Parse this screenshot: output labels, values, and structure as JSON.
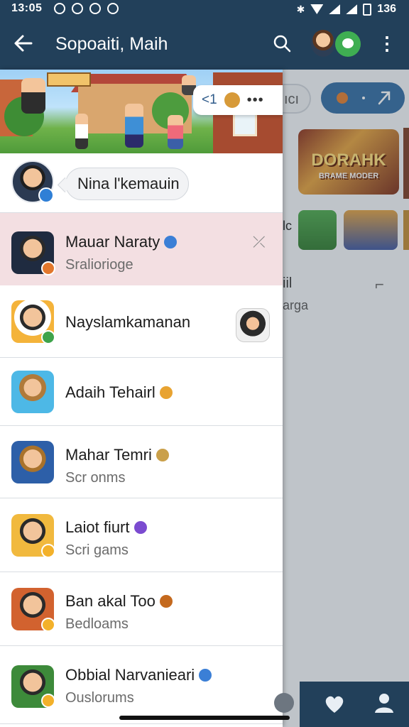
{
  "status_bar": {
    "time": "13:05",
    "battery": "136"
  },
  "app_bar": {
    "title": "Sopoaiti, Maih"
  },
  "drawer": {
    "banner_pill": {
      "label": "<1",
      "dots": "•••"
    },
    "profile": {
      "bubble_text": "Nina l'kemauin"
    },
    "chats": [
      {
        "name": "Mauar Naraty",
        "subtitle": "Sraliorioge",
        "trailing": "⤫",
        "active": true
      },
      {
        "name": "Nayslamkamanan",
        "subtitle": "",
        "active": false
      },
      {
        "name": "Adaih Tehairl",
        "subtitle": "",
        "active": false
      },
      {
        "name": "Mahar Temri",
        "subtitle": "Scr onms",
        "active": false
      },
      {
        "name": "Laiot fiurt",
        "subtitle": "Scri gams",
        "active": false
      },
      {
        "name": "Ban akal Too",
        "subtitle": "Bedloams",
        "active": false
      },
      {
        "name": "Obbial Narvanieari",
        "subtitle": "Ouslorums",
        "active": false
      }
    ]
  },
  "background_screen": {
    "pill_left": "ıcı",
    "game_title": "DORAHK",
    "game_subtitle": "BRAME MODER",
    "side_label": "lc",
    "item_title": "iil",
    "item_sub": "arga",
    "chevron": "⌐"
  },
  "colors": {
    "app_bar": "#22405a",
    "accent": "#2f6aa3",
    "active_row": "#f3dfe2"
  },
  "icons": [
    "back-arrow-icon",
    "search-icon",
    "more-vert-icon",
    "heart-icon",
    "person-icon"
  ]
}
